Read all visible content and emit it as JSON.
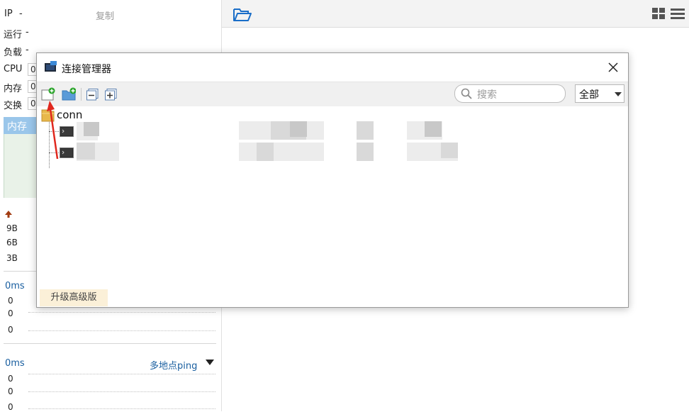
{
  "left_panel": {
    "ip_label": "IP",
    "ip_value": "-",
    "copy_label": "复制",
    "run_label": "运行",
    "run_value": "-",
    "load_label": "负载",
    "load_value": "-",
    "cpu_label": "CPU",
    "cpu_value": "0",
    "mem_label": "内存",
    "mem_value": "0",
    "swap_label": "交换",
    "swap_value": "0",
    "mem_tab_label": "内存",
    "net_values": [
      "9B",
      "6B",
      "3B"
    ],
    "latency1": {
      "title": "0ms",
      "values": [
        "0",
        "0",
        "0"
      ]
    },
    "latency2": {
      "title": "0ms",
      "dropdown_label": "多地点ping",
      "values": [
        "0",
        "0",
        "0"
      ]
    }
  },
  "dialog": {
    "title": "连接管理器",
    "search_placeholder": "搜索",
    "filter_value": "全部",
    "tree": {
      "folder_label": "conn",
      "children": [
        ".",
        "."
      ]
    },
    "upgrade_label": "升级高级版"
  },
  "colors": {
    "accent_blue": "#1a6ec8",
    "memory_header": "#9ac6ea",
    "upgrade_bg": "#fbf0d8",
    "annotation_red": "#e0281e"
  },
  "icons": [
    "folder-open-icon",
    "grid-view-icon",
    "menu-icon",
    "app-icon",
    "close-icon",
    "new-session-icon",
    "new-folder-icon",
    "collapse-all-icon",
    "expand-all-icon",
    "search-icon",
    "dropdown-arrow-icon",
    "folder-icon",
    "terminal-icon",
    "red-arrow-annotation"
  ]
}
